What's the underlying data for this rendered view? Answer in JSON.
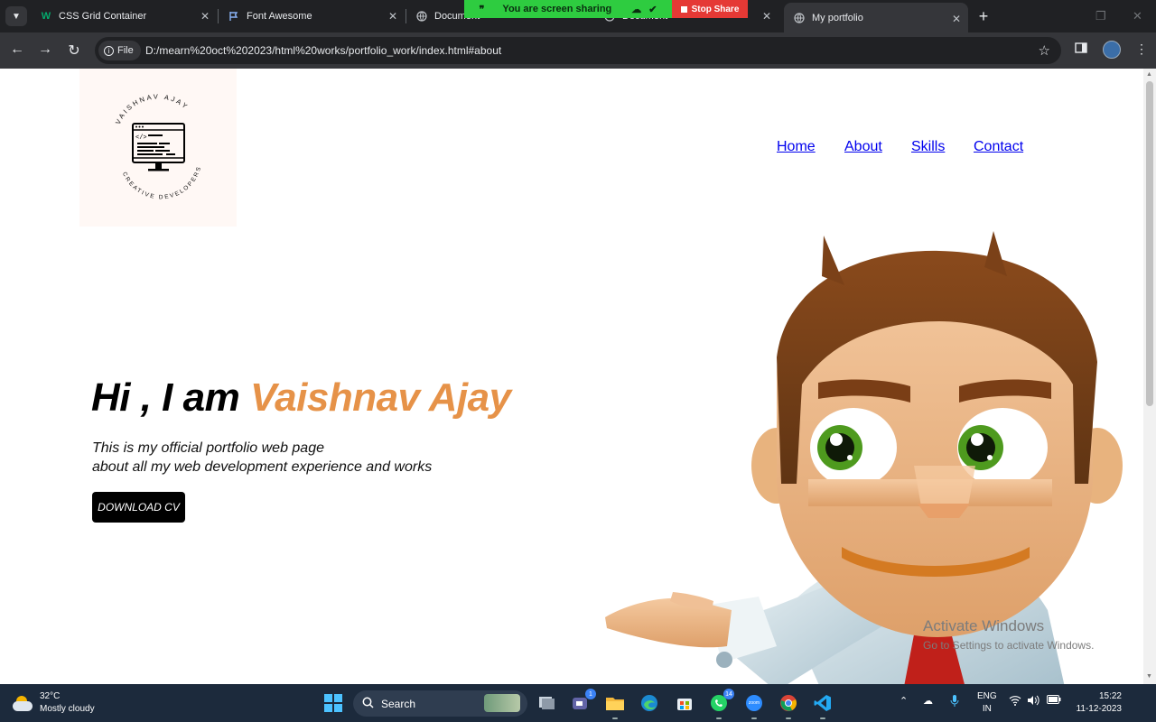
{
  "browser": {
    "tabs": [
      {
        "title": "CSS Grid Container",
        "icon": "w3schools-icon"
      },
      {
        "title": "Font Awesome",
        "icon": "flag-icon"
      },
      {
        "title": "Document",
        "icon": "globe-icon"
      },
      {
        "title": "Document",
        "icon": "globe-icon"
      },
      {
        "title": "My portfolio",
        "icon": "globe-icon",
        "active": true
      }
    ],
    "screen_share": {
      "status": "You are screen sharing",
      "stop_label": "Stop Share"
    },
    "file_chip": "File",
    "url": "D:/mearn%20oct%202023/html%20works/portfolio_work/index.html#about"
  },
  "page": {
    "logo": {
      "top_text": "VAISHNAV AJAY",
      "bottom_text": "CREATIVE DEVELOPERS"
    },
    "nav": [
      "Home",
      "About",
      "Skills",
      "Contact"
    ],
    "hero": {
      "greeting": "Hi , I am ",
      "name": "Vaishnav Ajay",
      "line1": "This is my official portfolio web page",
      "line2": "about all my web development experience and works",
      "cta": "DOWNLOAD CV"
    },
    "watermark": {
      "title": "Activate Windows",
      "subtitle": "Go to Settings to activate Windows."
    }
  },
  "taskbar": {
    "weather": {
      "temp": "32°C",
      "condition": "Mostly cloudy"
    },
    "search_label": "Search",
    "badges": {
      "teams": "1",
      "whatsapp": "14"
    },
    "zoom_label": "zoom",
    "lang": {
      "line1": "ENG",
      "line2": "IN"
    },
    "clock": {
      "time": "15:22",
      "date": "11-12-2023"
    }
  },
  "colors": {
    "accent_name": "#e69248",
    "nav_text": "#2d2150",
    "cta_bg": "#000000"
  }
}
